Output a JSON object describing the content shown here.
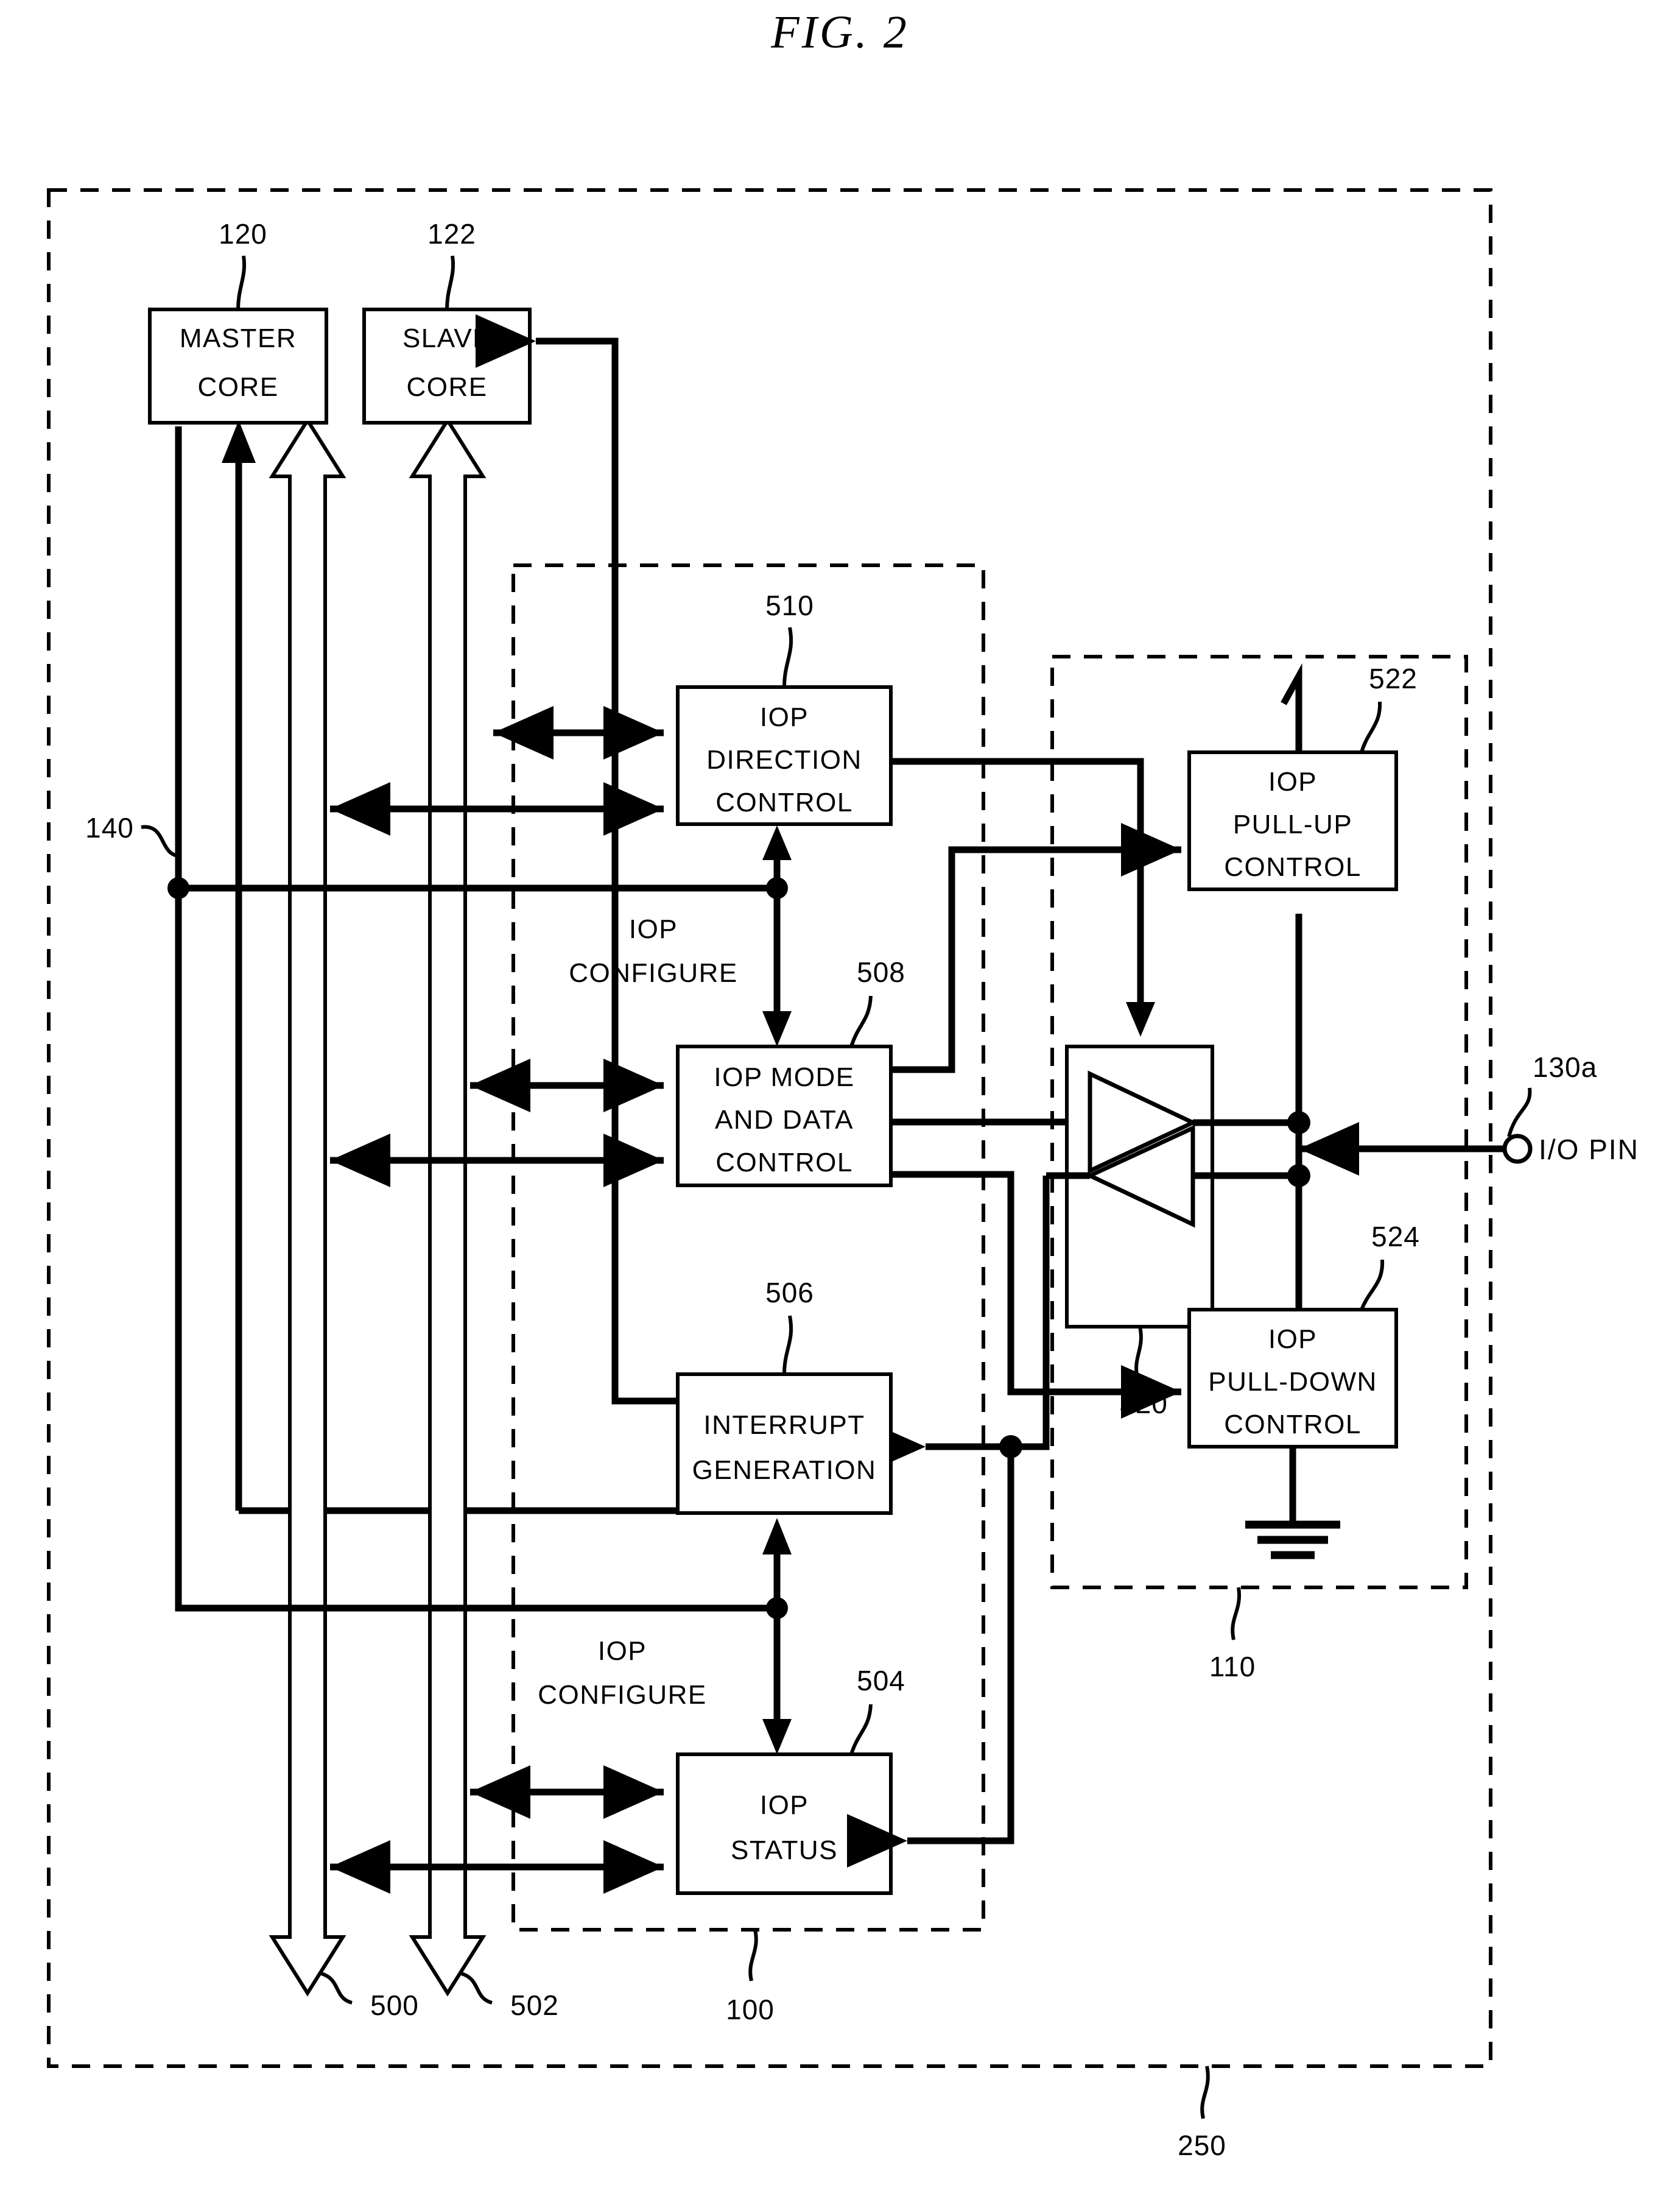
{
  "figure": {
    "title": "FIG.  2",
    "outer_ref": "250",
    "bus_ref": "140",
    "inner_iop_ref": "100",
    "pad_group_ref": "110"
  },
  "cores": {
    "master": {
      "line1": "MASTER",
      "line2": "CORE",
      "ref": "120"
    },
    "slave": {
      "line1": "SLAVE",
      "line2": "CORE",
      "ref": "122"
    }
  },
  "blocks": {
    "direction_control": {
      "line1": "IOP",
      "line2": "DIRECTION",
      "line3": "CONTROL",
      "ref": "510"
    },
    "mode_data_control": {
      "line1": "IOP  MODE",
      "line2": "AND  DATA",
      "line3": "CONTROL",
      "ref": "508"
    },
    "interrupt_generation": {
      "line1": "INTERRUPT",
      "line2": "GENERATION",
      "ref": "506"
    },
    "iop_status": {
      "line1": "IOP",
      "line2": "STATUS",
      "ref": "504"
    },
    "pull_up_control": {
      "line1": "IOP",
      "line2": "PULL-UP",
      "line3": "CONTROL",
      "ref": "522"
    },
    "pull_down_control": {
      "line1": "IOP",
      "line2": "PULL-DOWN",
      "line3": "CONTROL",
      "ref": "524"
    },
    "buffer": {
      "ref": "520"
    }
  },
  "signals": {
    "iop_configure_upper": {
      "line1": "IOP",
      "line2": "CONFIGURE"
    },
    "iop_configure_lower": {
      "line1": "IOP",
      "line2": "CONFIGURE"
    },
    "interrupt_master": {
      "ref": "500"
    },
    "interrupt_slave": {
      "ref": "502"
    }
  },
  "pin": {
    "label": "I/O  PIN",
    "ref": "130a"
  },
  "colors": {
    "ink": "#000000",
    "paper": "#ffffff"
  }
}
